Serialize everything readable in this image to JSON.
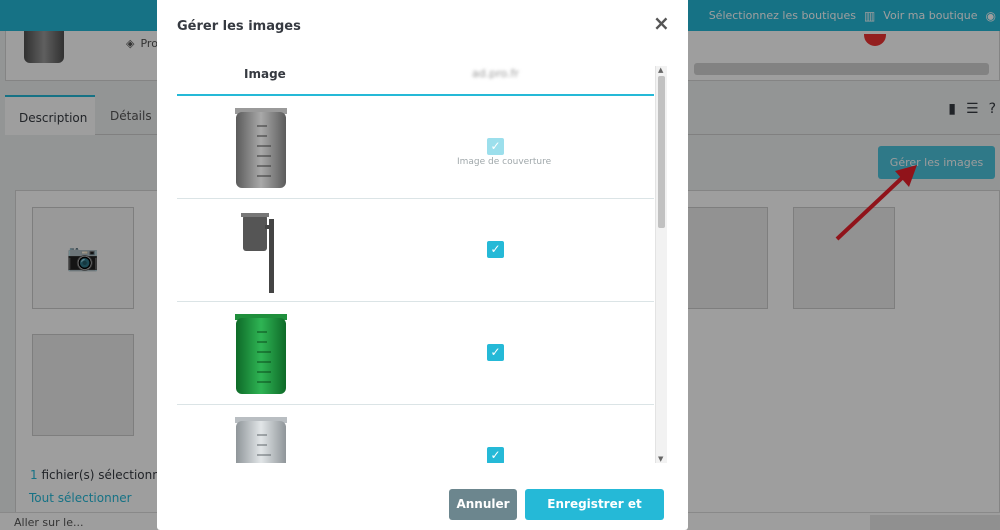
{
  "topbar": {
    "select_shops": "Sélectionnez les boutiques",
    "view_shop": "Voir ma boutique",
    "shop_icon": "store-icon",
    "eye_icon": "eye-icon"
  },
  "header": {
    "product_label": "Pro"
  },
  "tabs": [
    {
      "label": "Description",
      "active": true
    },
    {
      "label": "Détails",
      "active": false
    }
  ],
  "background": {
    "manage_images_button": "Gérer les images",
    "files_selected_count": "1",
    "files_selected_text": " fichier(s) sélectionné",
    "select_all": "Tout sélectionner",
    "footer_text": "Aller sur le..."
  },
  "modal": {
    "title": "Gérer les images",
    "column_image": "Image",
    "column_shop": "ad.pro.fr",
    "cover_label": "Image de couverture",
    "rows": [
      {
        "color": "#8a8a8a",
        "checked": true,
        "disabled": true,
        "cover": true
      },
      {
        "color": "#5a5a5a",
        "checked": true,
        "disabled": false,
        "cover": false
      },
      {
        "color": "#1f8f3c",
        "checked": true,
        "disabled": false,
        "cover": false
      },
      {
        "color": "#b9bec2",
        "checked": true,
        "disabled": false,
        "cover": false
      }
    ],
    "cancel_label": "Annuler",
    "save_label": "Enregistrer et publier"
  },
  "colors": {
    "accent": "#25b9d7",
    "secondary": "#6c868e"
  }
}
